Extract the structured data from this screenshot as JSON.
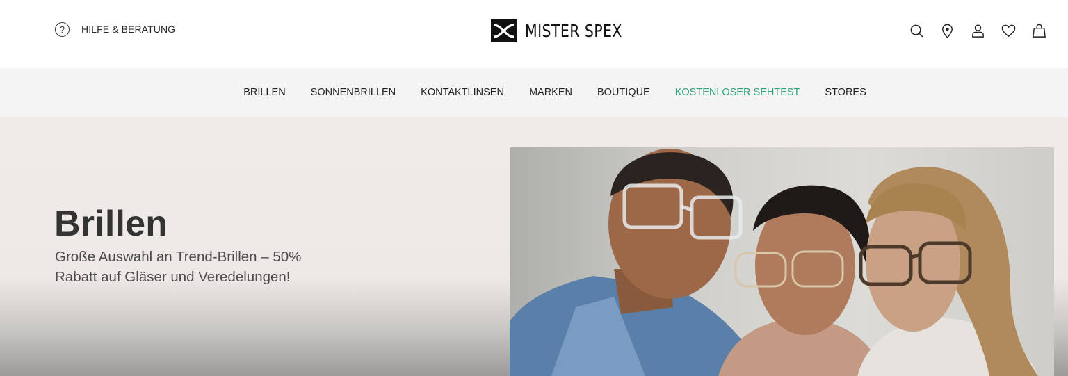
{
  "header": {
    "help_label": "HILFE & BERATUNG",
    "help_icon": "question-circle-icon",
    "logo_text": "MISTER SPEX",
    "icons": [
      "search-icon",
      "location-pin-icon",
      "user-icon",
      "heart-icon",
      "shopping-bag-icon"
    ]
  },
  "nav": {
    "items": [
      {
        "label": "BRILLEN"
      },
      {
        "label": "SONNENBRILLEN"
      },
      {
        "label": "KONTAKTLINSEN"
      },
      {
        "label": "MARKEN"
      },
      {
        "label": "BOUTIQUE"
      },
      {
        "label": "KOSTENLOSER SEHTEST",
        "highlight": true
      },
      {
        "label": "STORES"
      }
    ]
  },
  "hero": {
    "title": "Brillen",
    "subtitle_line1": "Große Auswahl an Trend-Brillen – 50%",
    "subtitle_line2": "Rabatt auf Gläser und Veredelungen!"
  },
  "colors": {
    "accent": "#2fa37a",
    "nav_bg": "#f4f4f4",
    "hero_bg": "#f0ebe8",
    "text": "#1e1e1e"
  }
}
